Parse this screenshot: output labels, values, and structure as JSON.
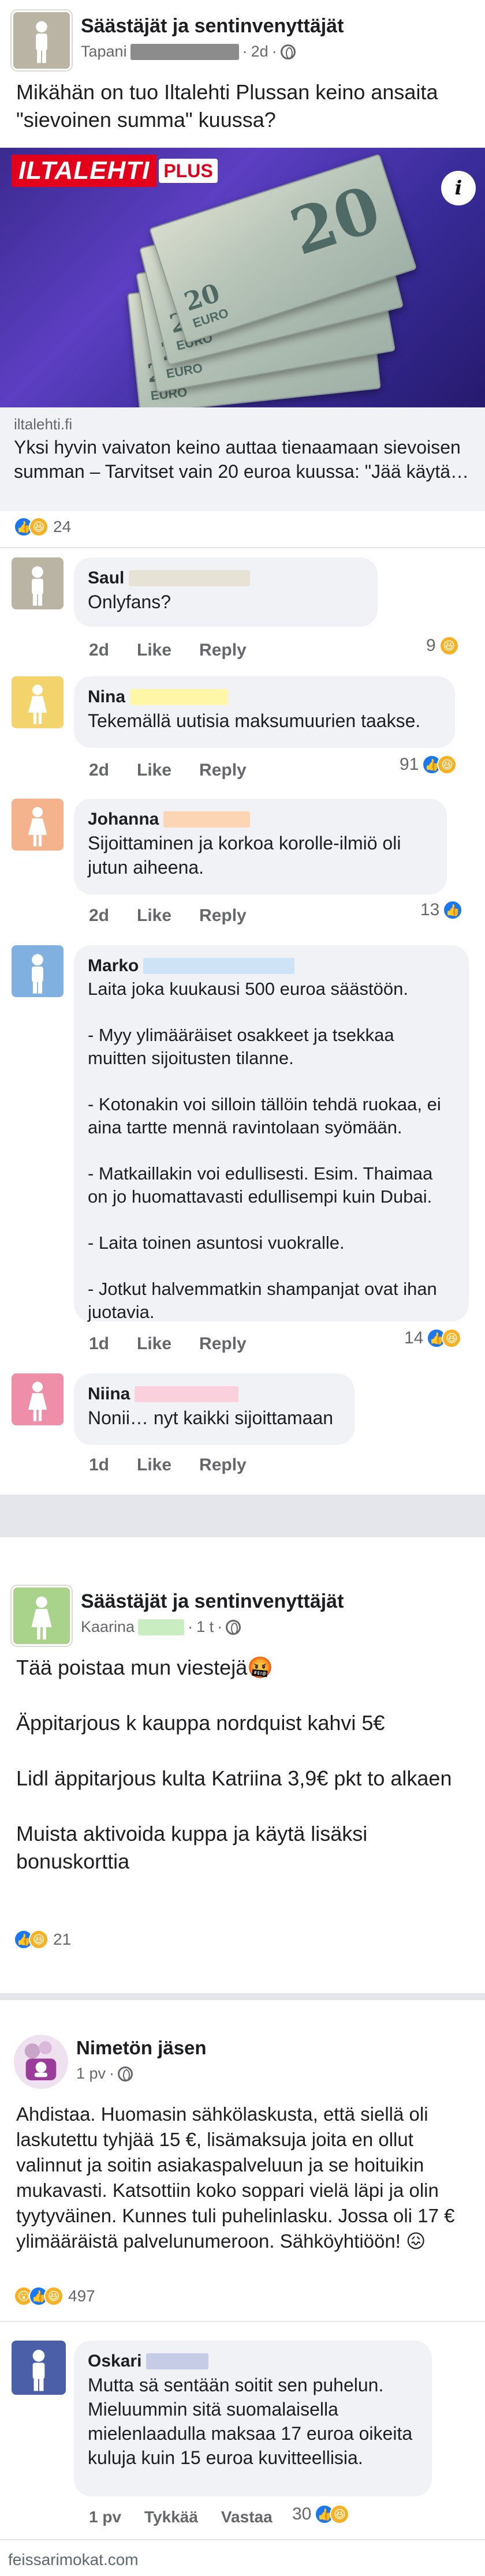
{
  "post1": {
    "group_name": "Säästäjät ja sentinvenyttäjät",
    "author": "Tapani",
    "time": "2d",
    "text": "Mikähän on tuo Iltalehti Plussan keino ansaita \"sievoinen summa\"  kuussa?",
    "link": {
      "logo": "ILTALEHTI",
      "logo_plus": "PLUS",
      "domain": "iltalehti.fi",
      "description": "Yksi hyvin vaivaton keino auttaa tienaamaan sievoisen summan – Tarvitset vain 20 euroa kuussa: \"Jää käytä…"
    },
    "reactions_count": "24",
    "comments": [
      {
        "name": "Saul",
        "redact_color": "#e6e2d6",
        "text": "Onlyfans?",
        "time": "2d",
        "like": "Like",
        "reply": "Reply",
        "react_count": "9",
        "avatar_color": "#b9b4a4"
      },
      {
        "name": "Nina",
        "redact_color": "#fff6a8",
        "text": "Tekemällä uutisia maksumuurien taakse.",
        "time": "2d",
        "like": "Like",
        "reply": "Reply",
        "react_count": "91",
        "avatar_color": "#f3d36b"
      },
      {
        "name": "Johanna",
        "redact_color": "#fcd5b5",
        "text": "Sijoittaminen ja korkoa korolle-ilmiö oli jutun aiheena.",
        "time": "2d",
        "like": "Like",
        "reply": "Reply",
        "react_count": "13",
        "avatar_color": "#f5b38d"
      },
      {
        "name": "Marko",
        "redact_color": "#cfe3f7",
        "text": "Laita joka kuukausi 500 euroa säästöön.\n\n- Myy ylimääräiset osakkeet ja tsekkaa muitten sijoitusten tilanne.\n\n- Kotonakin voi silloin tällöin tehdä ruokaa, ei aina tartte mennä ravintolaan syömään.\n\n- Matkaillakin voi edullisesti. Esim. Thaimaa on jo huomattavasti edullisempi kuin Dubai.\n\n- Laita toinen asuntosi vuokralle.\n\n- Jotkut halvemmatkin shampanjat ovat ihan juotavia.",
        "time": "1d",
        "like": "Like",
        "reply": "Reply",
        "react_count": "14",
        "avatar_color": "#7fb0e0"
      },
      {
        "name": "Niina",
        "redact_color": "#fbd0dd",
        "text": "Nonii… nyt kaikki sijoittamaan",
        "time": "1d",
        "like": "Like",
        "reply": "Reply",
        "react_count": "",
        "avatar_color": "#ef8ea8"
      }
    ]
  },
  "post2": {
    "group_name": "Säästäjät ja sentinvenyttäjät",
    "author": "Kaarina",
    "time": "1 t",
    "text": "Tää poistaa mun viestejä🤬\n\nÄppitarjous k kauppa nordquist kahvi 5€\n\nLidl äppitarjous kulta Katriina 3,9€ pkt to alkaen\n\nMuista aktivoida kuppa ja käytä lisäksi bonuskorttia",
    "reactions_count": "21"
  },
  "post3": {
    "author": "Nimetön jäsen",
    "time": "1 pv",
    "text": "Ahdistaa. Huomasin sähkölaskusta, että siellä oli laskutettu tyhjää 15 €, lisämaksuja joita en ollut valinnut ja soitin asiakaspalveluun ja se hoituikin mukavasti. Katsottiin koko soppari vielä läpi ja olin tyytyväinen. Kunnes tuli puhelinlasku. Jossa oli 17 € ylimääräistä palvelunumeroon. Sähköyhtiöön! 😖",
    "reactions_count": "497",
    "comment": {
      "name": "Oskari",
      "text": "Mutta sä sentään soitit sen puhelun. Mieluummin sitä suomalaisella mielenlaadulla maksaa 17 euroa oikeita kuluja kuin 15 euroa kuvitteellisia.",
      "time": "1 pv",
      "like": "Tykkää",
      "reply": "Vastaa",
      "react_count": "30"
    }
  },
  "footer": "feissarimokat.com",
  "colors": {
    "like_blue": "#1877f2",
    "haha_yellow": "#f7b125",
    "separator": "#e4e6eb",
    "link_bg": "#f0f2f5"
  }
}
